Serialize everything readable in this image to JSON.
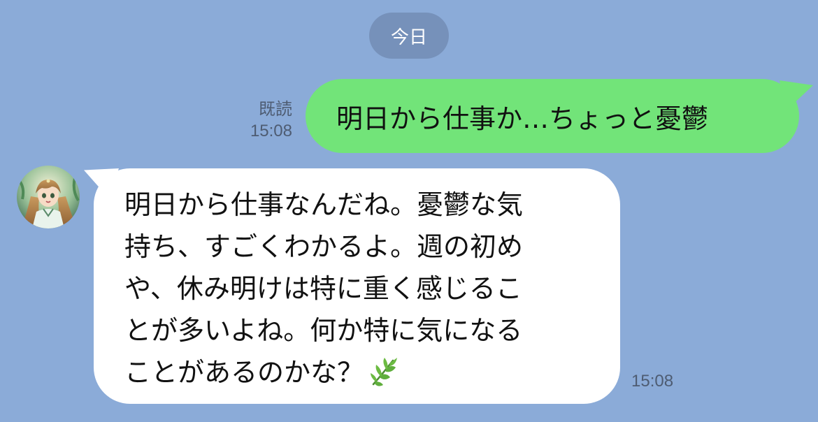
{
  "chat": {
    "date_divider": "今日",
    "sent": {
      "text": "明日から仕事か…ちょっと憂鬱",
      "read_label": "既読",
      "time": "15:08"
    },
    "received": {
      "lines": [
        "明日から仕事なんだね。憂鬱な気",
        "持ち、すごくわかるよ。週の初め",
        "や、休み明けは特に重く感じるこ",
        "とが多いよね。何か特に気になる",
        "ことがあるのかな？"
      ],
      "trailing_icon": "herb-leaf-icon",
      "time": "15:08"
    }
  },
  "colors": {
    "background": "#8babd8",
    "date_pill": "#7691ba",
    "sent_bubble": "#72e479",
    "received_bubble": "#ffffff",
    "meta_text": "#4e5c72",
    "leaf_green": "#5fae3c"
  }
}
